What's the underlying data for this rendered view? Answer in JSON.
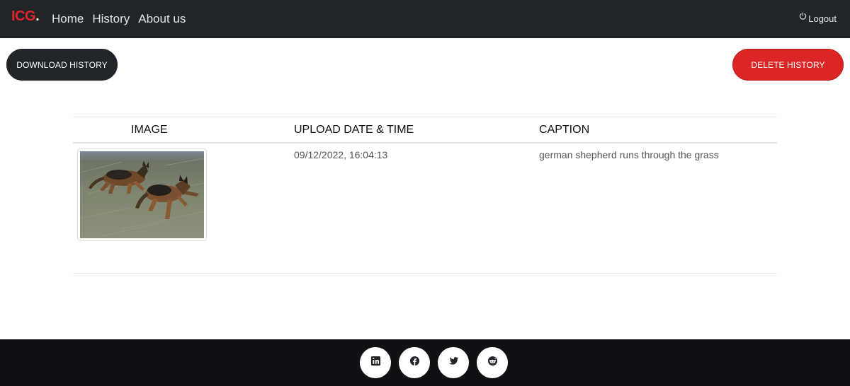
{
  "navbar": {
    "brand": "ICG",
    "brand_dot": ".",
    "links": [
      {
        "label": "Home"
      },
      {
        "label": "History"
      },
      {
        "label": "About us"
      }
    ],
    "logout_label": "Logout",
    "logout_icon": "power-icon"
  },
  "actions": {
    "download_label": "DOWNLOAD HISTORY",
    "delete_label": "DELETE HISTORY"
  },
  "table": {
    "headers": [
      "IMAGE",
      "UPLOAD DATE & TIME",
      "CAPTION"
    ],
    "rows": [
      {
        "image_icon": "dog-photo-thumbnail",
        "upload_datetime": "09/12/2022, 16:04:13",
        "caption": "german shepherd runs through the grass"
      }
    ]
  },
  "footer": {
    "social": [
      {
        "icon": "linkedin-icon"
      },
      {
        "icon": "facebook-icon"
      },
      {
        "icon": "twitter-icon"
      },
      {
        "icon": "reddit-icon"
      }
    ]
  },
  "colors": {
    "navbar_bg": "#212529",
    "brand_red": "#e0262c",
    "delete_red": "#dc2626",
    "footer_bg": "#121014"
  }
}
